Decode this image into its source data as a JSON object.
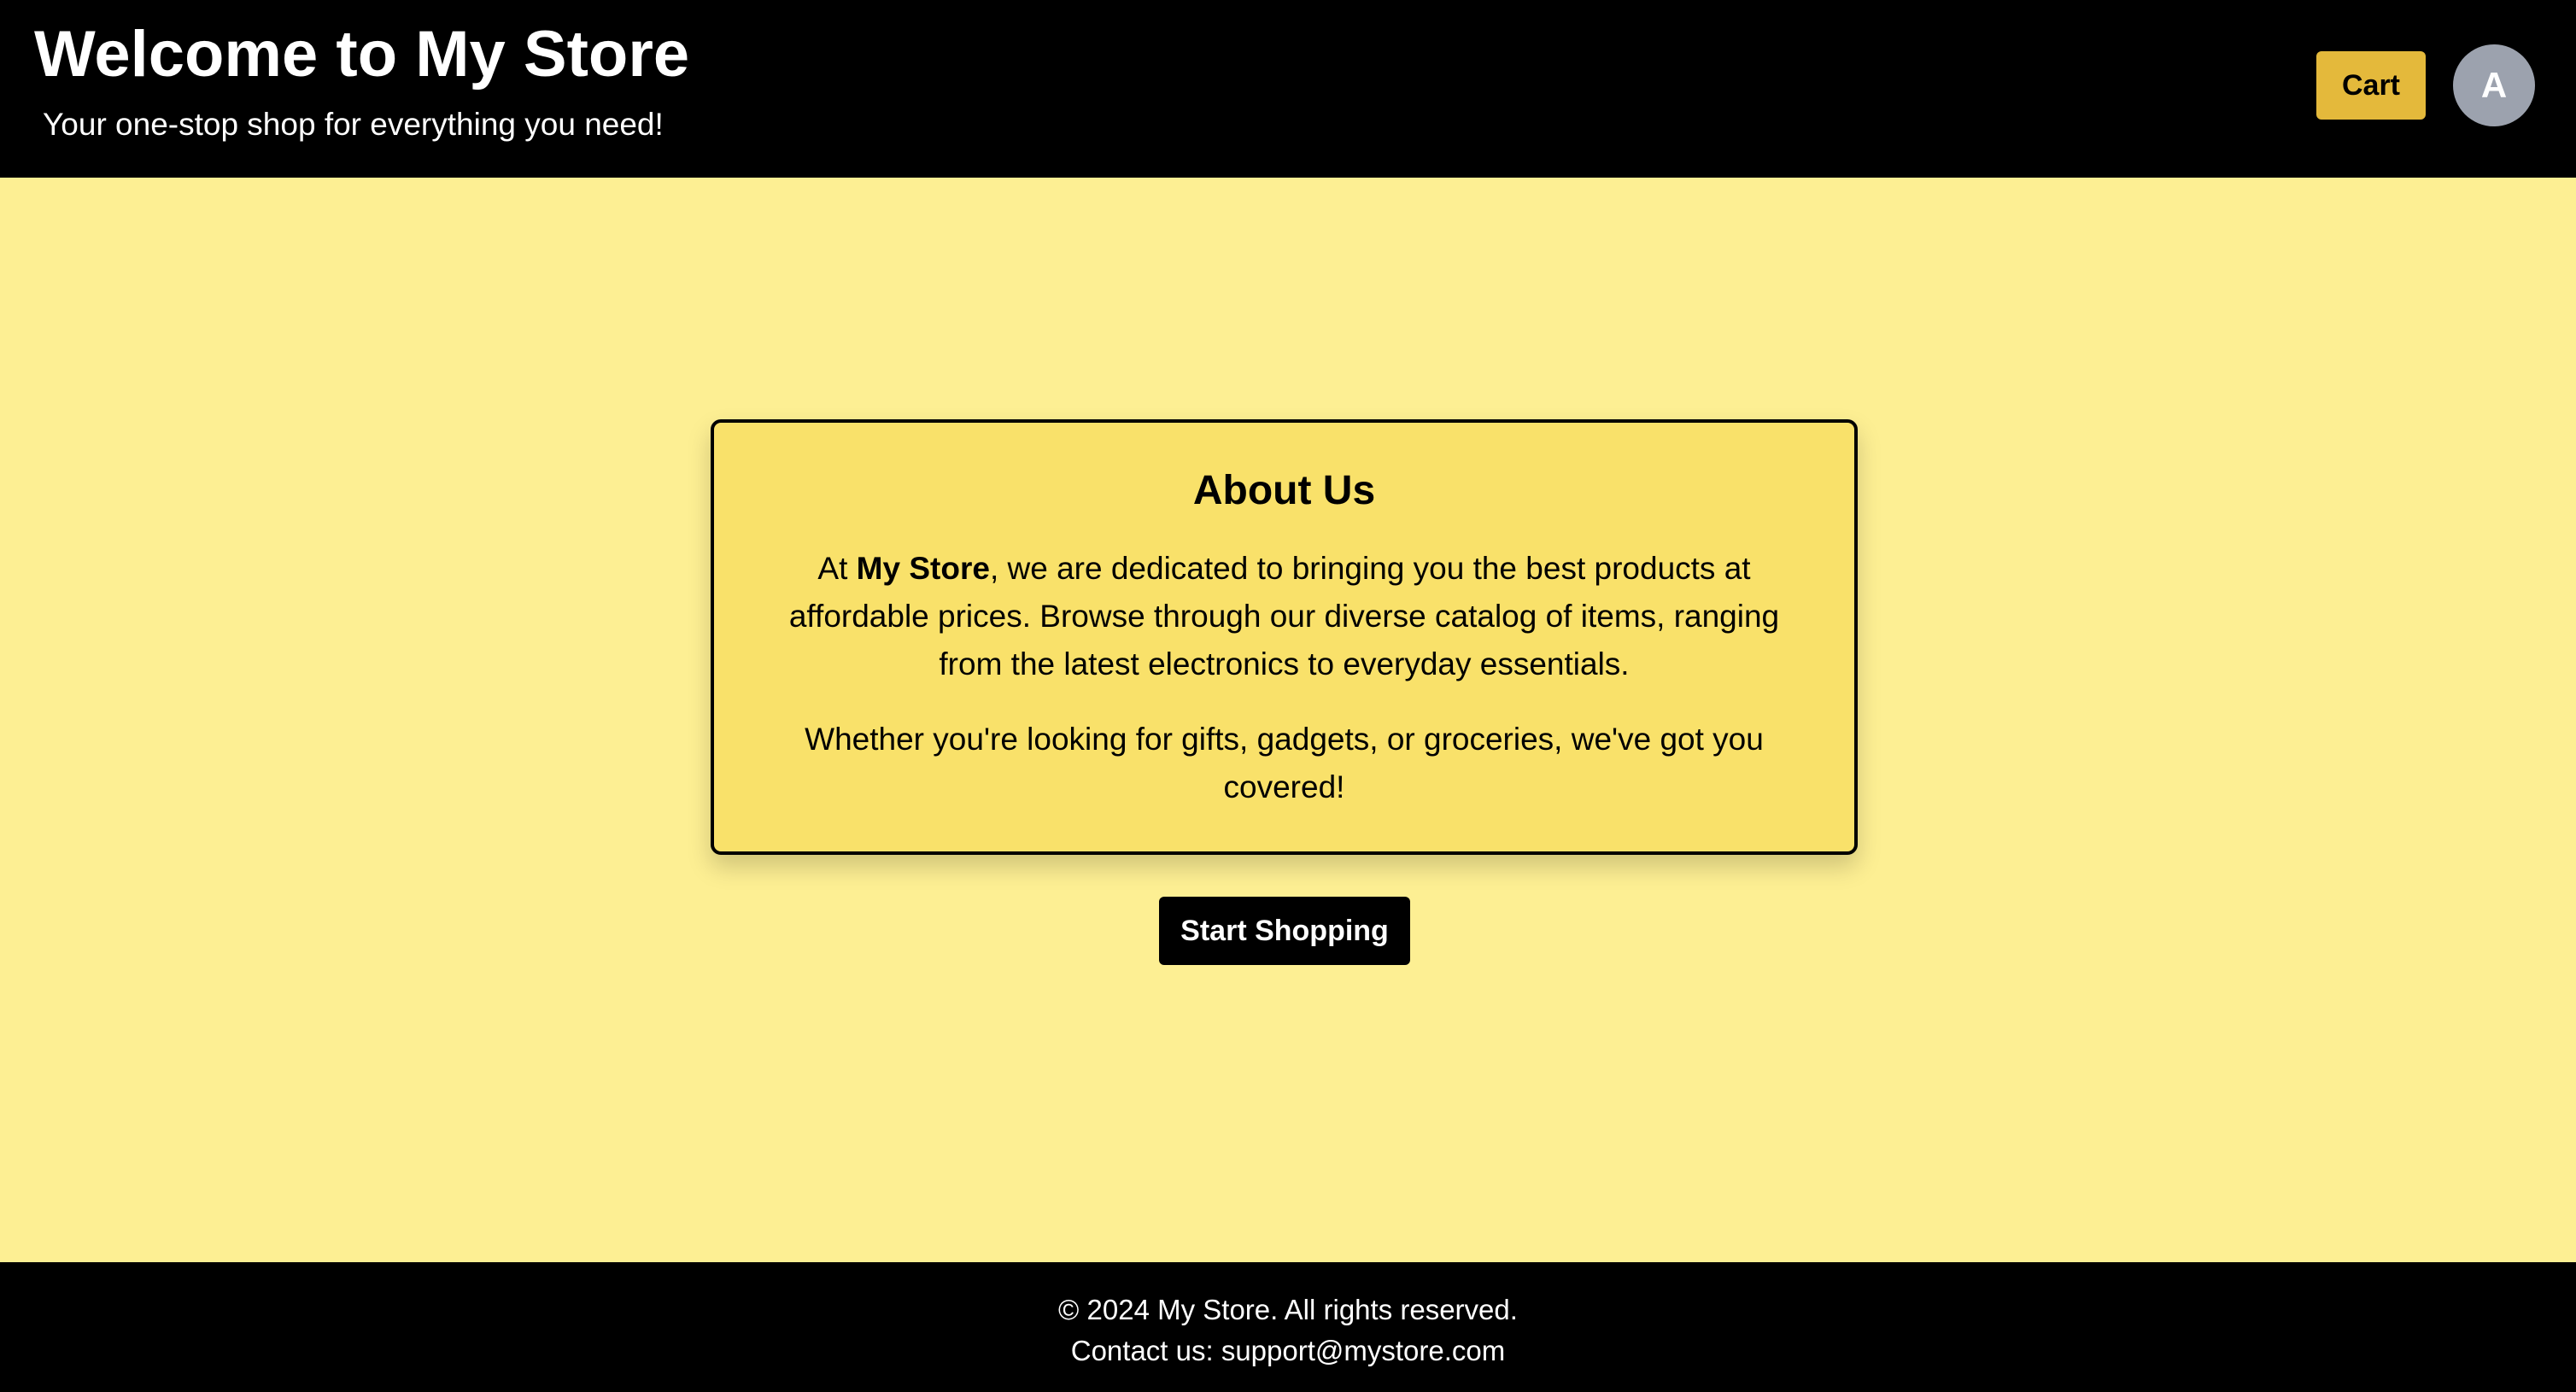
{
  "header": {
    "title": "Welcome to My Store",
    "tagline": "Your one-stop shop for everything you need!",
    "cart_label": "Cart",
    "avatar_initial": "A"
  },
  "about": {
    "heading": "About Us",
    "para1_before": "At ",
    "para1_brand": "My Store",
    "para1_after": ", we are dedicated to bringing you the best products at affordable prices. Browse through our diverse catalog of items, ranging from the latest electronics to everyday essentials.",
    "para2": "Whether you're looking for gifts, gadgets, or groceries, we've got you covered!"
  },
  "cta": {
    "label": "Start Shopping"
  },
  "footer": {
    "copyright": "© 2024 My Store. All rights reserved.",
    "contact": "Contact us: support@mystore.com"
  },
  "colors": {
    "header_bg": "#000000",
    "page_bg": "#fdef93",
    "card_bg": "#f9e16a",
    "cart_button_bg": "#e4b93b",
    "avatar_bg": "#9ca2ae",
    "cta_bg": "#000000",
    "footer_bg": "#000000"
  }
}
